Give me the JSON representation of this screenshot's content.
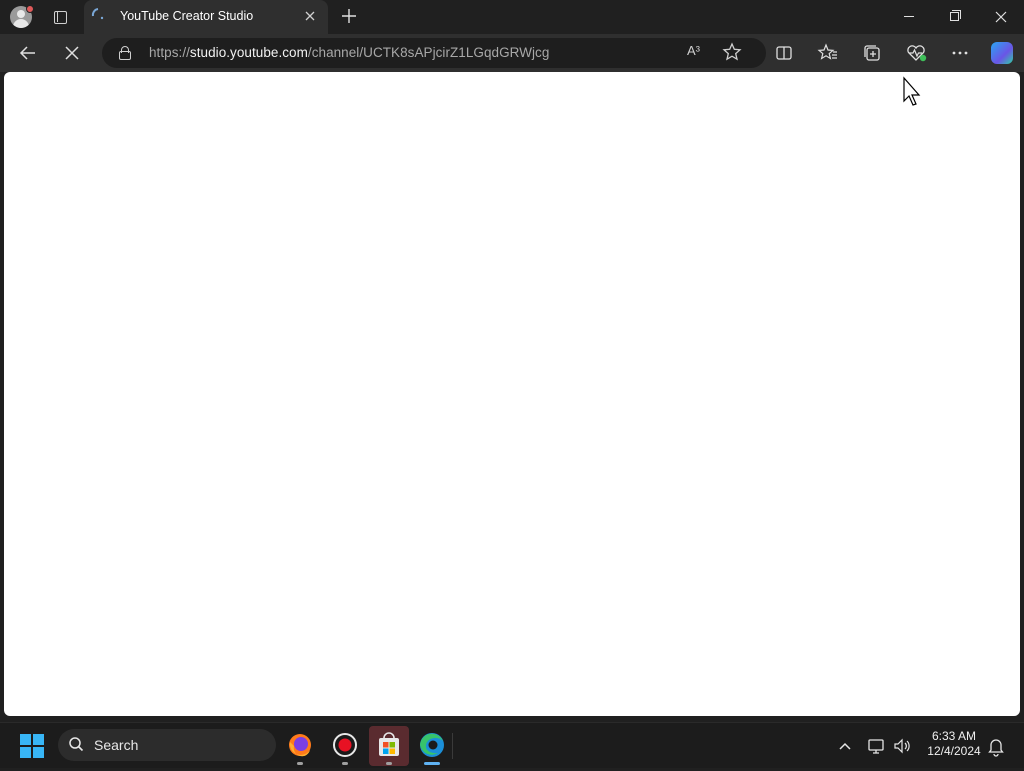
{
  "browser": {
    "tab": {
      "title": "YouTube Creator Studio"
    },
    "address_bar": {
      "url_prefix": "https://",
      "url_host": "studio.youtube.com",
      "url_path": "/channel/UCTK8sAPjcirZ1LGqdGRWjcg",
      "read_aloud_label": "A³"
    }
  },
  "taskbar": {
    "search_label": "Search",
    "apps": [
      "Firefox",
      "Recorder",
      "Microsoft Store",
      "Microsoft Edge"
    ],
    "clock": {
      "time": "6:33 AM",
      "date": "12/4/2024"
    }
  },
  "colors": {
    "accent": "#5fb2f2",
    "windows_blue": "#38b6f6"
  }
}
